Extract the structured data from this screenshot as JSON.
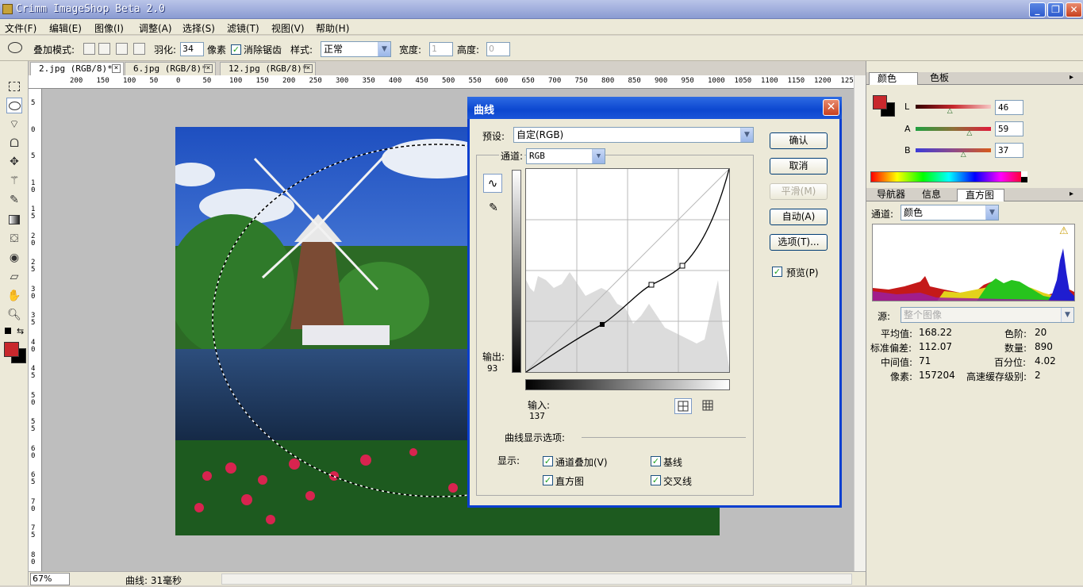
{
  "window": {
    "title": "Crimm ImageShop Beta 2.0",
    "min": "_",
    "restore": "❐",
    "close": "✕"
  },
  "menu": [
    "文件(F)",
    "编辑(E)",
    "图像(I)",
    "调整(A)",
    "选择(S)",
    "滤镜(T)",
    "视图(V)",
    "帮助(H)"
  ],
  "options": {
    "blend_label": "叠加模式:",
    "feather_label": "羽化:",
    "feather_value": "34",
    "feather_unit": "像素",
    "antialias_label": "消除锯齿",
    "antialias_checked": true,
    "style_label": "样式:",
    "style_value": "正常",
    "width_label": "宽度:",
    "width_value": "1",
    "height_label": "高度:",
    "height_value": "0"
  },
  "tabs": [
    {
      "label": "2.jpg (RGB/8)*"
    },
    {
      "label": "6.jpg (RGB/8)*"
    },
    {
      "label": "12.jpg (RGB/8)*"
    }
  ],
  "ruler": {
    "h": [
      "200",
      "150",
      "100",
      "50",
      "0",
      "50",
      "100",
      "150",
      "200",
      "250",
      "300",
      "350",
      "400",
      "450",
      "500",
      "550",
      "600",
      "650",
      "700",
      "750",
      "800",
      "850",
      "900",
      "950",
      "1000",
      "1050",
      "1100",
      "1150",
      "1200",
      "125"
    ],
    "v": [
      "5",
      "0",
      "5",
      "1 0",
      "1 5",
      "2 0",
      "2 5",
      "3 0",
      "3 5",
      "4 0",
      "4 5",
      "5 0",
      "5 5",
      "6 0",
      "6 5",
      "7 0",
      "7 5",
      "8 0"
    ]
  },
  "status": {
    "zoom": "67%",
    "message": "曲线: 31毫秒"
  },
  "color_panel": {
    "tabs": [
      "颜色",
      "色板"
    ],
    "channels": [
      {
        "name": "L",
        "value": "46",
        "pos": 0.46
      },
      {
        "name": "A",
        "value": "59",
        "pos": 0.72
      },
      {
        "name": "B",
        "value": "37",
        "pos": 0.64
      }
    ],
    "fg_color": "#c8282d",
    "bg_color": "#000000"
  },
  "histogram_panel": {
    "tabs": [
      "导航器",
      "信息",
      "直方图"
    ],
    "channel_label": "通道:",
    "channel_value": "颜色",
    "source_label": "源:",
    "source_value": "整个图像",
    "stats": {
      "mean_label": "平均值:",
      "mean": "168.22",
      "level_label": "色阶:",
      "level": "20",
      "std_label": "标准偏差:",
      "std": "112.07",
      "count_label": "数量:",
      "count": "890",
      "median_label": "中间值:",
      "median": "71",
      "percent_label": "百分位:",
      "percent": "4.02",
      "pixels_label": "像素:",
      "pixels": "157204",
      "cache_label": "高速缓存级别:",
      "cache": "2"
    }
  },
  "curves_dialog": {
    "title": "曲线",
    "preset_label": "预设:",
    "preset_value": "自定(RGB)",
    "channel_label": "通道:",
    "channel_value": "RGB",
    "buttons": {
      "ok": "确认",
      "cancel": "取消",
      "smooth": "平滑(M)",
      "auto": "自动(A)",
      "options": "选项(T)..."
    },
    "preview_label": "预览(P)",
    "preview_checked": true,
    "output_label": "输出:",
    "output_value": "93",
    "input_label": "输入:",
    "input_value": "137",
    "display_options_label": "曲线显示选项:",
    "show_label": "显示:",
    "show_options": [
      {
        "label": "通道叠加(V)",
        "checked": true
      },
      {
        "label": "基线",
        "checked": true
      },
      {
        "label": "直方图",
        "checked": true
      },
      {
        "label": "交叉线",
        "checked": true
      }
    ]
  }
}
